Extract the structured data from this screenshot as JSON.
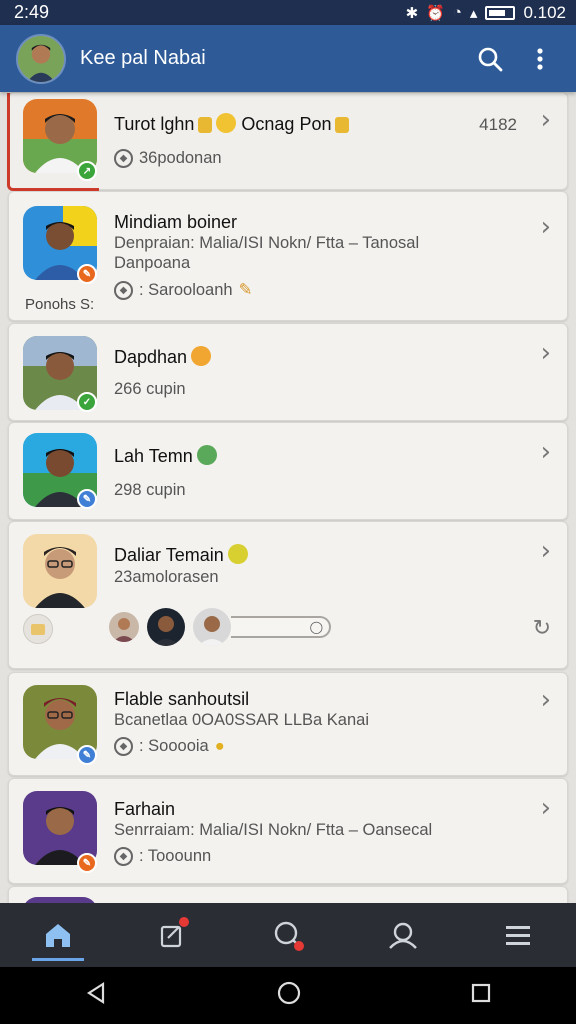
{
  "status_bar": {
    "time": "2:49",
    "right_text": "0.102"
  },
  "app_bar": {
    "title": "Kee pal Nabai",
    "search_icon": "search-icon",
    "menu_icon": "more-vert-icon"
  },
  "chats": [
    {
      "name": "Turot lghn",
      "name_suffix": "Ocnag Pon",
      "time": "4182",
      "sub": "",
      "meta": "36podonan"
    },
    {
      "name": "Mindiam boiner",
      "sub": "Denpraian: Malia/ISI Nokn/ Ftta – Tanosal",
      "sub2": "Danpoana",
      "meta": ": Sarooloanh",
      "side_label": "Ponohs S:"
    },
    {
      "name": "Dapdhan",
      "sub": "",
      "meta": "266 cupin"
    },
    {
      "name": "Lah Temn",
      "sub": "",
      "meta": "298 cupin"
    },
    {
      "name": "Daliar Temain",
      "sub": "23amolorasen",
      "meta": ""
    },
    {
      "name": "Flable sanhoutsil",
      "sub": "Bcanetlaa 0OA0SSAR LLBa Kanai",
      "meta": ": Sooooia"
    },
    {
      "name": "Farhain",
      "sub": "Senrraiam: Malia/ISI Nokn/ Ftta – Oansecal",
      "meta": ": Tooounn"
    }
  ],
  "bottom_nav": [
    {
      "icon": "home-icon",
      "active": true
    },
    {
      "icon": "compose-icon",
      "active": false
    },
    {
      "icon": "search-chat-icon",
      "active": false
    },
    {
      "icon": "contacts-icon",
      "active": false
    },
    {
      "icon": "menu-icon",
      "active": false
    }
  ],
  "colors": {
    "app_bar": "#2e5b98",
    "status_bar": "#1f2f4f",
    "accent_green": "#3aa53a",
    "accent_orange": "#e8681e",
    "accent_blue": "#3f7fd6"
  }
}
